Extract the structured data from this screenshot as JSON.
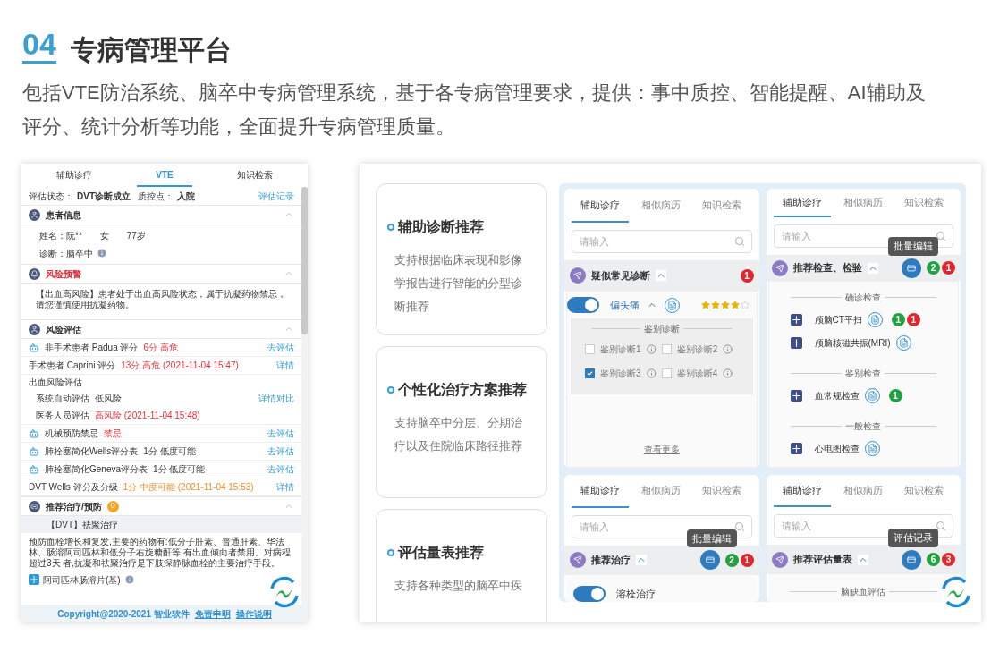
{
  "header": {
    "number": "04",
    "title": "专病管理平台",
    "description": "包括VTE防治系统、脑卒中专病管理系统，基于各专病管理要求，提供：事中质控、智能提醒、AI辅助及评分、统计分析等功能，全面提升专病管理质量。"
  },
  "vte": {
    "tabs": [
      {
        "label": "辅助诊疗",
        "selected": false
      },
      {
        "label": "VTE",
        "selected": true
      },
      {
        "label": "知识检索",
        "selected": false
      }
    ],
    "status": {
      "label": "评估状态：",
      "value": "DVT诊断成立",
      "qc_label": "质控点：",
      "qc_value": "入院",
      "link": "评估记录"
    },
    "patient": {
      "title": "患者信息",
      "name_label": "姓名：",
      "name": "阮**",
      "sex": "女",
      "age": "77岁",
      "diagnosis_label": "诊断：",
      "diagnosis": "脑卒中"
    },
    "warning": {
      "title": "风险预警",
      "text": "【出血高风险】患者处于出血高风险状态，属于抗凝药物禁忌，请您谨慎使用抗凝药物。"
    },
    "assessment": {
      "title": "风险评估",
      "rows": [
        {
          "kind": "score",
          "ai": true,
          "label": "非手术患者 Padua 评分",
          "result": "6分 高危",
          "warning": true,
          "caution": false,
          "action": "去评估"
        },
        {
          "kind": "score",
          "ai": false,
          "label": "手术患者 Caprini 评分",
          "result": "13分 高危 (2021-11-04 15:47)",
          "warning": true,
          "caution": false,
          "action": "详情"
        },
        {
          "kind": "group",
          "label": "出血风险评估",
          "children": [
            {
              "label": "系统自动评估",
              "result": "低风险",
              "warning": false,
              "caution": false,
              "action": "详情对比"
            },
            {
              "label": "医务人员评估",
              "result": "高风险 (2021-11-04 15:48)",
              "warning": true,
              "caution": false
            }
          ]
        },
        {
          "kind": "score",
          "ai": true,
          "label": "机械预防禁忌",
          "result": "禁忌",
          "warning": true,
          "caution": false,
          "action": "去评估"
        },
        {
          "kind": "score",
          "ai": true,
          "label": "肺栓塞简化Wells评分表",
          "result": "1分 低度可能",
          "warning": false,
          "caution": false,
          "action": "去评估"
        },
        {
          "kind": "score",
          "ai": true,
          "label": "肺栓塞简化Geneva评分表",
          "result": "1分 低度可能",
          "warning": false,
          "caution": false,
          "action": "去评估"
        },
        {
          "kind": "score",
          "ai": false,
          "label": "DVT Wells 评分及分级",
          "result": "1分 中度可能 (2021-11-04 15:53)",
          "warning": false,
          "caution": true,
          "action": "详情"
        }
      ]
    },
    "treatment": {
      "title": "推荐治疗/预防",
      "count": "0",
      "plan": "【DVT】祛聚治疗",
      "text": "预防血栓增长和复发,主要的药物有:低分子肝素、普通肝素、华法林、肠溶阿司匹林和低分子右旋糖酐等,有出血倾向者禁用。对病程超过3天 者,抗凝和祛聚治疗是下肢深静脉血栓的主要治疗手段。",
      "drug": "阿司匹林肠溶片(基)"
    },
    "footer": {
      "copyright": "Copyright@2020-2021 智业软件",
      "links": [
        "免责申明",
        "操作说明"
      ]
    }
  },
  "features": [
    {
      "title": "辅助诊断推荐",
      "description": "支持根据临床表现和影像学报告进行智能的分型诊断推荐"
    },
    {
      "title": "个性化治疗方案推荐",
      "description": "支持脑卒中分层、分期治疗以及住院临床路径推荐"
    },
    {
      "title": "评估量表推荐",
      "description": "支持各种类型的脑卒中疾"
    }
  ],
  "panels": [
    {
      "tabs": [
        {
          "label": "辅助诊疗",
          "selected": true
        },
        {
          "label": "相似病历",
          "selected": false
        },
        {
          "label": "知识检索",
          "selected": false
        }
      ],
      "search_placeholder": "请输入",
      "section": {
        "title": "疑似常见诊断",
        "badges": [
          {
            "text": "1",
            "color": "#e0262e"
          }
        ]
      },
      "body": {
        "kind": "diagnosis",
        "item": {
          "label": "偏头痛",
          "on": true,
          "stars": 4
        },
        "group_title": "鉴别诊断",
        "options": [
          {
            "label": "鉴别诊断1",
            "checked": false
          },
          {
            "label": "鉴别诊断2",
            "checked": false
          },
          {
            "label": "鉴别诊断3",
            "checked": true
          },
          {
            "label": "鉴别诊断4",
            "checked": false
          }
        ],
        "more": "查看更多"
      }
    },
    {
      "tabs": [
        {
          "label": "辅助诊疗",
          "selected": true
        },
        {
          "label": "相似病历",
          "selected": false
        },
        {
          "label": "知识检索",
          "selected": false
        }
      ],
      "search_placeholder": "请输入",
      "tooltip": "批量编辑",
      "section": {
        "title": "推荐检查、检验",
        "badges": [
          {
            "text": "2",
            "color": "#23a044"
          },
          {
            "text": "1",
            "color": "#e0262e"
          }
        ]
      },
      "body": {
        "kind": "exams",
        "groups": [
          {
            "title": "确诊检查",
            "items": [
              {
                "label": "颅脑CT平扫",
                "badges": [
                  {
                    "text": "1",
                    "color": "#23a044"
                  },
                  {
                    "text": "1",
                    "color": "#e0262e"
                  }
                ]
              },
              {
                "label": "颅脑核磁共振(MRI)"
              }
            ]
          },
          {
            "title": "鉴别检查",
            "items": [
              {
                "label": "血常规检查",
                "badges": [
                  {
                    "text": "1",
                    "color": "#23a044"
                  }
                ]
              }
            ]
          },
          {
            "title": "一般检查",
            "items": [
              {
                "label": "心电图检查"
              }
            ]
          }
        ]
      }
    },
    {
      "tabs": [
        {
          "label": "辅助诊疗",
          "selected": true
        },
        {
          "label": "相似病历",
          "selected": false
        },
        {
          "label": "知识检索",
          "selected": false
        }
      ],
      "search_placeholder": "请输入",
      "tooltip": "批量编辑",
      "section": {
        "title": "推荐治疗",
        "badges": [
          {
            "text": "2",
            "color": "#23a044"
          },
          {
            "text": "1",
            "color": "#e0262e"
          }
        ]
      },
      "body": {
        "kind": "treatment",
        "item": {
          "label": "溶栓治疗",
          "on": true
        }
      }
    },
    {
      "tabs": [
        {
          "label": "辅助诊疗",
          "selected": true
        },
        {
          "label": "相似病历",
          "selected": false
        },
        {
          "label": "知识检索",
          "selected": false
        }
      ],
      "search_placeholder": "请输入",
      "tooltip": "评估记录",
      "section": {
        "title": "推荐评估量表",
        "badges": [
          {
            "text": "6",
            "color": "#23a044"
          },
          {
            "text": "3",
            "color": "#e0262e"
          }
        ]
      },
      "body": {
        "kind": "scales",
        "groups": [
          {
            "title": "脑缺血评估"
          }
        ]
      }
    }
  ]
}
